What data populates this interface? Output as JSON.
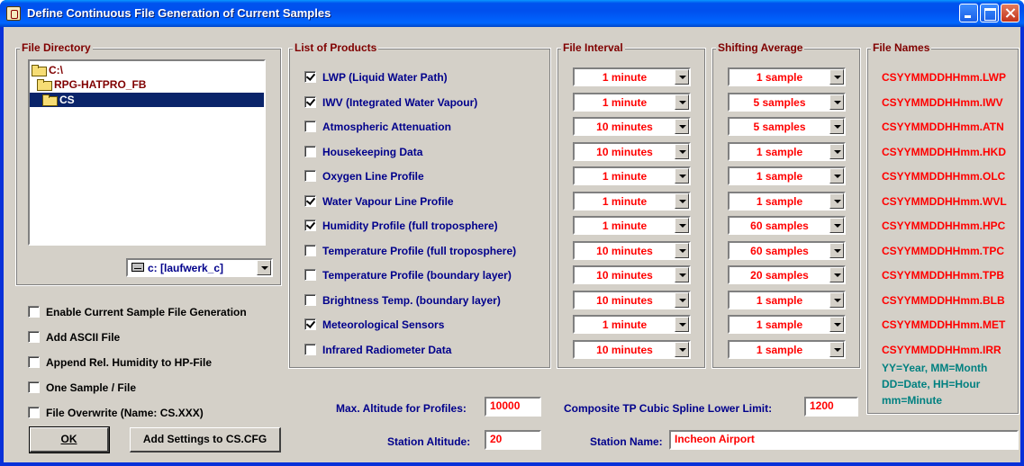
{
  "window": {
    "title": "Define Continuous File Generation of Current Samples"
  },
  "file_directory": {
    "label": "File Directory",
    "tree": [
      {
        "label": "C:\\",
        "selected": false
      },
      {
        "label": "RPG-HATPRO_FB",
        "selected": false
      },
      {
        "label": "CS",
        "selected": true
      }
    ],
    "drive": "c: [laufwerk_c]"
  },
  "options": [
    {
      "label": "Enable Current Sample File Generation",
      "checked": false
    },
    {
      "label": "Add ASCII File",
      "checked": false
    },
    {
      "label": "Append Rel. Humidity to HP-File",
      "checked": false
    },
    {
      "label": "One Sample / File",
      "checked": false
    },
    {
      "label": "File Overwrite (Name: CS.XXX)",
      "checked": false
    }
  ],
  "buttons": {
    "ok": "OK",
    "add_settings": "Add Settings to CS.CFG"
  },
  "headers": {
    "products": "List of Products",
    "interval": "File Interval",
    "average": "Shifting Average",
    "names": "File Names"
  },
  "products": [
    {
      "label": "LWP (Liquid Water Path)",
      "checked": true,
      "interval": "1 minute",
      "average": "1 sample",
      "file": "CSYYMMDDHHmm.LWP"
    },
    {
      "label": "IWV (Integrated Water Vapour)",
      "checked": true,
      "interval": "1 minute",
      "average": "5 samples",
      "file": "CSYYMMDDHHmm.IWV"
    },
    {
      "label": "Atmospheric Attenuation",
      "checked": false,
      "interval": "10 minutes",
      "average": "5 samples",
      "file": "CSYYMMDDHHmm.ATN"
    },
    {
      "label": "Housekeeping Data",
      "checked": false,
      "interval": "10 minutes",
      "average": "1 sample",
      "file": "CSYYMMDDHHmm.HKD"
    },
    {
      "label": "Oxygen Line Profile",
      "checked": false,
      "interval": "1 minute",
      "average": "1 sample",
      "file": "CSYYMMDDHHmm.OLC"
    },
    {
      "label": "Water Vapour Line Profile",
      "checked": true,
      "interval": "1 minute",
      "average": "1 sample",
      "file": "CSYYMMDDHHmm.WVL"
    },
    {
      "label": "Humidity Profile (full troposphere)",
      "checked": true,
      "interval": "1 minute",
      "average": "60 samples",
      "file": "CSYYMMDDHHmm.HPC"
    },
    {
      "label": "Temperature Profile (full troposphere)",
      "checked": false,
      "interval": "10 minutes",
      "average": "60 samples",
      "file": "CSYYMMDDHHmm.TPC"
    },
    {
      "label": "Temperature Profile (boundary layer)",
      "checked": false,
      "interval": "10 minutes",
      "average": "20 samples",
      "file": "CSYYMMDDHHmm.TPB"
    },
    {
      "label": "Brightness Temp. (boundary layer)",
      "checked": false,
      "interval": "10 minutes",
      "average": "1 sample",
      "file": "CSYYMMDDHHmm.BLB"
    },
    {
      "label": "Meteorological Sensors",
      "checked": true,
      "interval": "1 minute",
      "average": "1 sample",
      "file": "CSYYMMDDHHmm.MET"
    },
    {
      "label": "Infrared Radiometer Data",
      "checked": false,
      "interval": "10 minutes",
      "average": "1 sample",
      "file": "CSYYMMDDHHmm.IRR"
    }
  ],
  "legend": [
    "YY=Year, MM=Month",
    "DD=Date, HH=Hour",
    "mm=Minute"
  ],
  "fields": {
    "max_altitude_label": "Max. Altitude for Profiles:",
    "max_altitude": "10000",
    "composite_label": "Composite TP Cubic Spline Lower Limit:",
    "composite": "1200",
    "station_altitude_label": "Station Altitude:",
    "station_altitude": "20",
    "station_name_label": "Station Name:",
    "station_name": "Incheon Airport"
  }
}
